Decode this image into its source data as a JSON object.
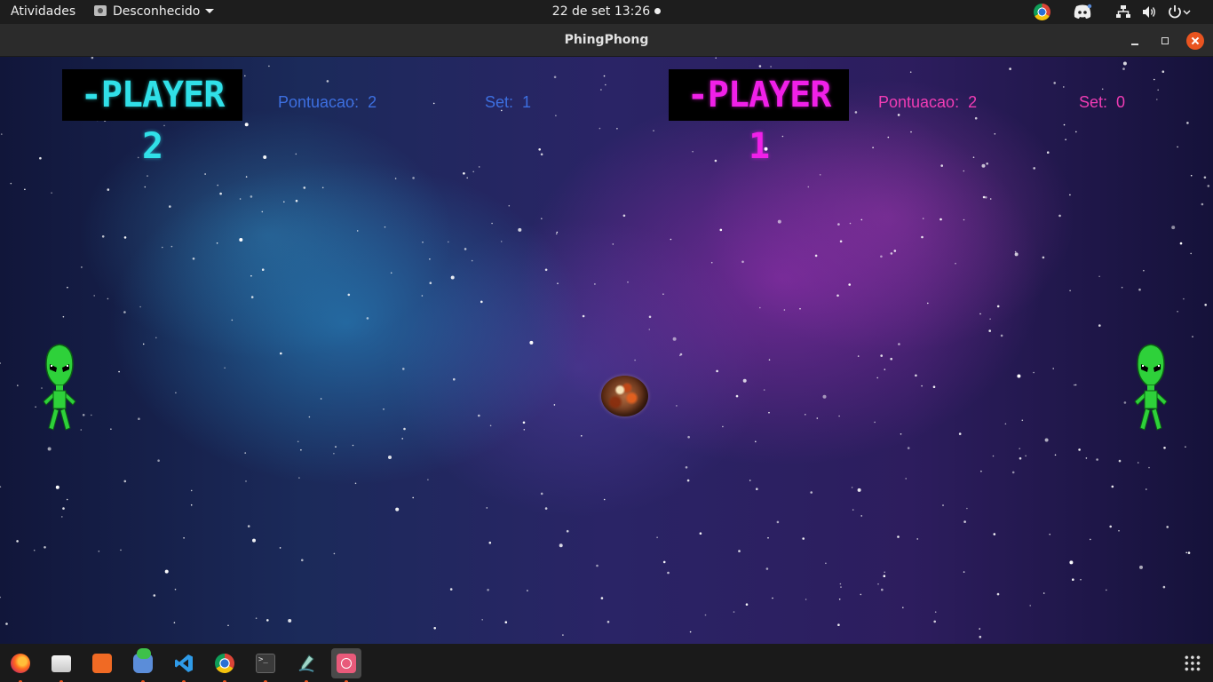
{
  "topbar": {
    "activities": "Atividades",
    "app_menu": "Desconhecido",
    "clock": "22 de set  13:26",
    "tray_icons": [
      "chrome-icon",
      "discord-icon",
      "network-icon",
      "volume-icon",
      "power-icon",
      "chevron-down-icon"
    ]
  },
  "window": {
    "title": "PhingPhong",
    "controls": [
      "minimize",
      "maximize",
      "close"
    ]
  },
  "game": {
    "player2": {
      "banner": "-PLAYER 2",
      "score_label": "Pontuacao:  2",
      "set_label": "Set:  1",
      "color": "#3d6fe0",
      "banner_color": "#30e0e8"
    },
    "player1": {
      "banner": "-PLAYER 1",
      "score_label": "Pontuacao:  2",
      "set_label": "Set:  0",
      "color": "#f03cb4",
      "banner_color": "#f020e8"
    },
    "paddle_icon": "alien-icon",
    "ball_icon": "planet-ball-icon"
  },
  "dock": {
    "apps": [
      "firefox",
      "files",
      "ubuntu-software",
      "messages",
      "visual-studio-code",
      "chrome",
      "terminal",
      "inkscape",
      "phingphong"
    ],
    "show_apps_icon": "grid-icon",
    "accent": "#e95420"
  }
}
